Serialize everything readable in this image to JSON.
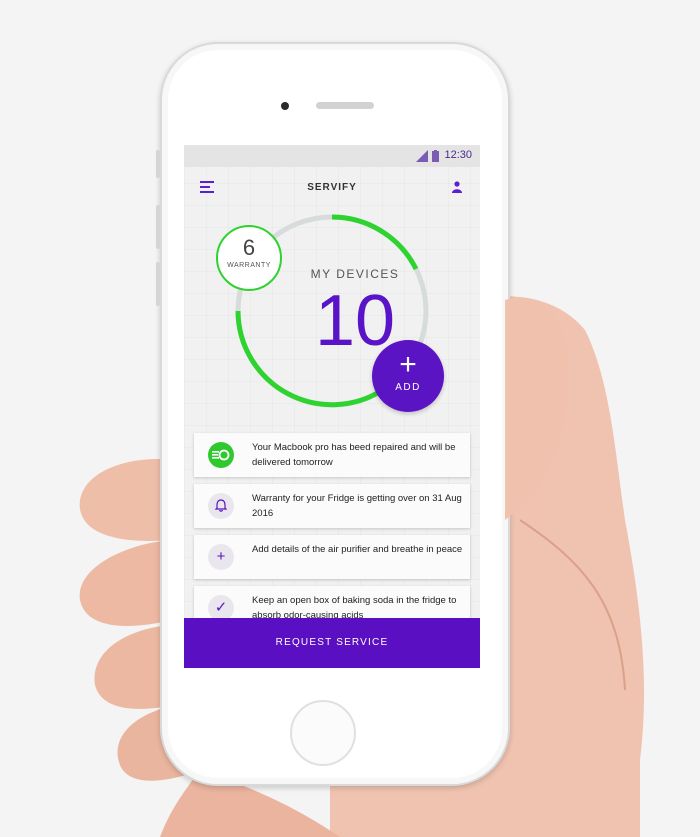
{
  "status_bar": {
    "time": "12:30"
  },
  "header": {
    "title": "SERVIFY"
  },
  "summary": {
    "warranty_count": "6",
    "warranty_label": "WARRANTY",
    "devices_label": "MY DEVICES",
    "devices_count": "10",
    "add_label": "ADD"
  },
  "notifications": [
    {
      "icon": "repair-icon",
      "text": "Your Macbook pro has beed repaired and will be delivered tomorrow"
    },
    {
      "icon": "bell-icon",
      "text": "Warranty for your Fridge is getting over on 31 Aug 2016"
    },
    {
      "icon": "plus-icon",
      "text": "Add details of the air purifier and breathe in peace"
    },
    {
      "icon": "check-icon",
      "text": "Keep an open box of baking soda in the fridge to absorb odor-causing acids"
    }
  ],
  "footer": {
    "request_label": "REQUEST SERVICE"
  },
  "colors": {
    "accent": "#5b14c4",
    "ring": "#2fd32f"
  }
}
